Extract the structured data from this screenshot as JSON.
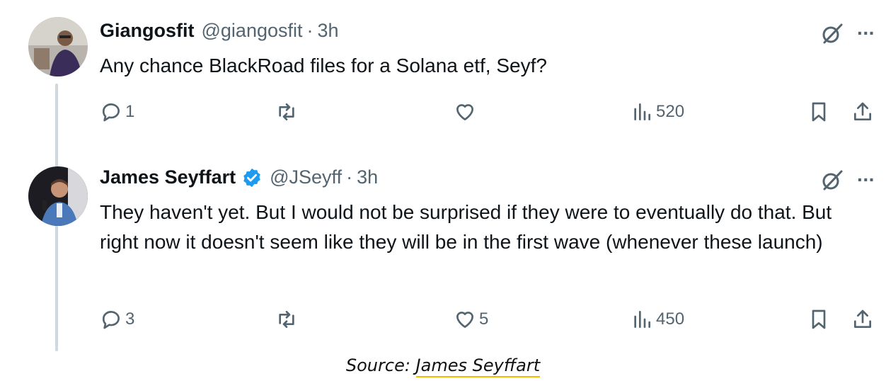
{
  "tweets": [
    {
      "name": "Giangosfit",
      "handle": "@giangosfit",
      "time": "3h",
      "verified": false,
      "text": "Any chance BlackRoad files for a Solana etf, Seyf?",
      "stats": {
        "replies": "1",
        "retweets": "",
        "likes": "",
        "views": "520"
      }
    },
    {
      "name": "James Seyffart",
      "handle": "@JSeyff",
      "time": "3h",
      "verified": true,
      "text": "They haven't yet. But I would not be surprised if they were to eventually do that. But right now it doesn't seem like they will be in the first wave (whenever these launch)",
      "stats": {
        "replies": "3",
        "retweets": "",
        "likes": "5",
        "views": "450"
      }
    }
  ],
  "separator": "·",
  "more_label": "···",
  "source": {
    "prefix": "Source: ",
    "link_text": "James Seyffart"
  },
  "colors": {
    "text": "#0f1419",
    "muted": "#536471",
    "verified": "#1d9bf0",
    "thread_line": "#cfd9de",
    "underline": "#f5b800"
  }
}
